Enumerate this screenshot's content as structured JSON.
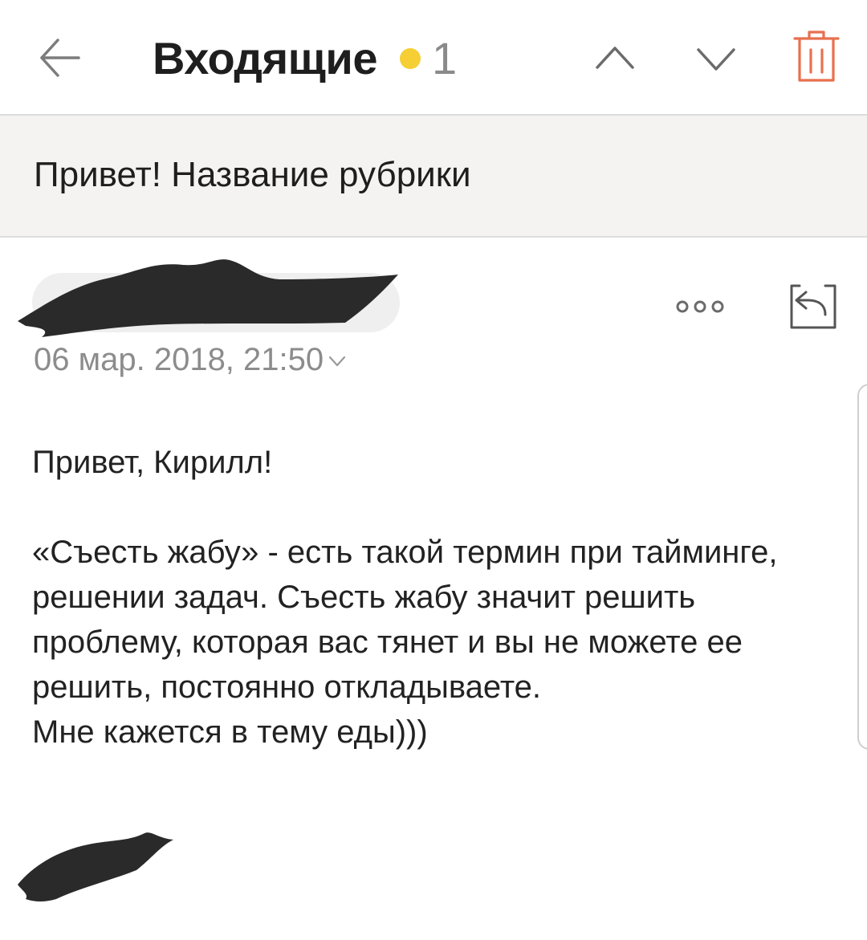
{
  "toolbar": {
    "back_icon": "arrow-left-icon",
    "folder_title": "Входящие",
    "unread_count": "1",
    "prev_icon": "chevron-up-icon",
    "next_icon": "chevron-down-icon",
    "delete_icon": "trash-icon"
  },
  "message": {
    "subject": "Привет! Название рубрики",
    "date": "06 мар. 2018, 21:50",
    "greeting": "Привет, Кирилл!",
    "paragraph_lines": [
      "«Съесть жабу» - есть такой термин при тайминге,",
      "решении задач. Съесть жабу значит решить",
      "проблему, которая вас тянет и вы не можете ее",
      "решить, постоянно откладываете."
    ],
    "closing": "Мне кажется в тему еды)))",
    "more_icon": "more-dots-icon",
    "reply_icon": "reply-icon"
  },
  "colors": {
    "unread_dot": "#f5cf33",
    "delete_icon": "#e8704f",
    "subject_band": "#f4f3f2",
    "redaction": "#2a2a2a"
  }
}
